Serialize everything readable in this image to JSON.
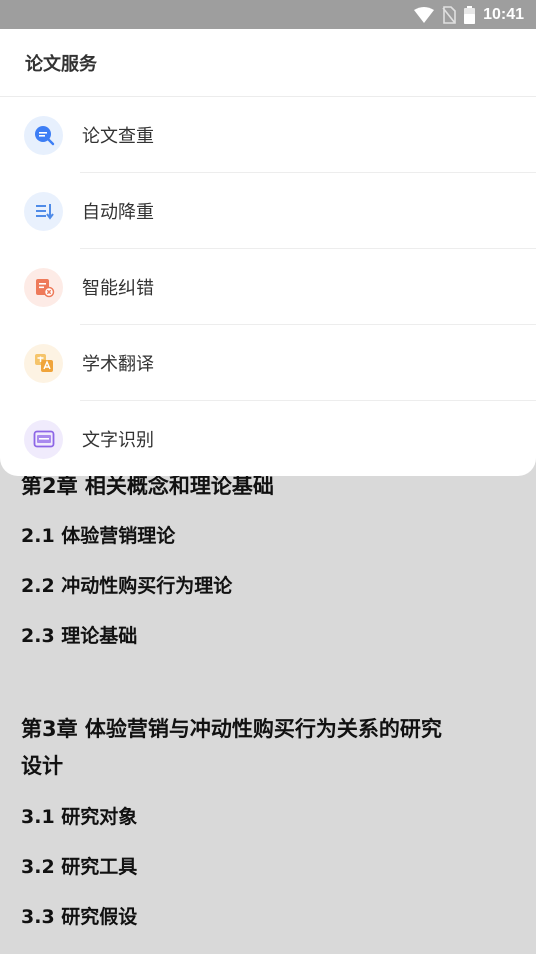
{
  "status_bar": {
    "time": "10:41"
  },
  "sheet": {
    "title": "论文服务",
    "items": [
      {
        "label": "论文查重",
        "icon": "plagiarism-check-icon",
        "bg": "#e7f0fd",
        "color": "#3d7ef5"
      },
      {
        "label": "自动降重",
        "icon": "auto-rewrite-icon",
        "bg": "#e9f1fd",
        "color": "#4f8be8"
      },
      {
        "label": "智能纠错",
        "icon": "smart-correction-icon",
        "bg": "#fdebe6",
        "color": "#ee7a5a"
      },
      {
        "label": "学术翻译",
        "icon": "academic-translate-icon",
        "bg": "#fdf3e3",
        "color": "#f0a43a"
      },
      {
        "label": "文字识别",
        "icon": "ocr-icon",
        "bg": "#f0ebfc",
        "color": "#8d66e6"
      }
    ]
  },
  "document": {
    "lines": [
      {
        "text": "第2章 相关概念和理论基础",
        "kind": "chapter"
      },
      {
        "text": "2.1 体验营销理论",
        "kind": "section"
      },
      {
        "text": "2.2 冲动性购买行为理论",
        "kind": "section"
      },
      {
        "text": "2.3 理论基础",
        "kind": "section"
      },
      {
        "text": "第3章 体验营销与冲动性购买行为关系的研究",
        "kind": "chapter"
      },
      {
        "text": "设计",
        "kind": "chapter"
      },
      {
        "text": "3.1 研究对象",
        "kind": "section"
      },
      {
        "text": "3.2 研究工具",
        "kind": "section"
      },
      {
        "text": "3.3 研究假设",
        "kind": "section"
      }
    ]
  }
}
